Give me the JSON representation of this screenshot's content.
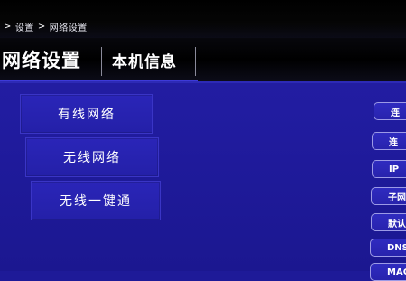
{
  "breadcrumb": [
    "设置",
    "网络设置"
  ],
  "tabs": [
    {
      "label": "网络设置"
    },
    {
      "label": "本机信息"
    }
  ],
  "menu": [
    {
      "label": "有线网络"
    },
    {
      "label": "无线网络"
    },
    {
      "label": "无线一键通"
    }
  ],
  "right_buttons": [
    {
      "label": "连"
    },
    {
      "label": "连"
    },
    {
      "label": "IP"
    },
    {
      "label": "子网"
    },
    {
      "label": "默认"
    },
    {
      "label": "DNS"
    },
    {
      "label": "MAC"
    }
  ]
}
